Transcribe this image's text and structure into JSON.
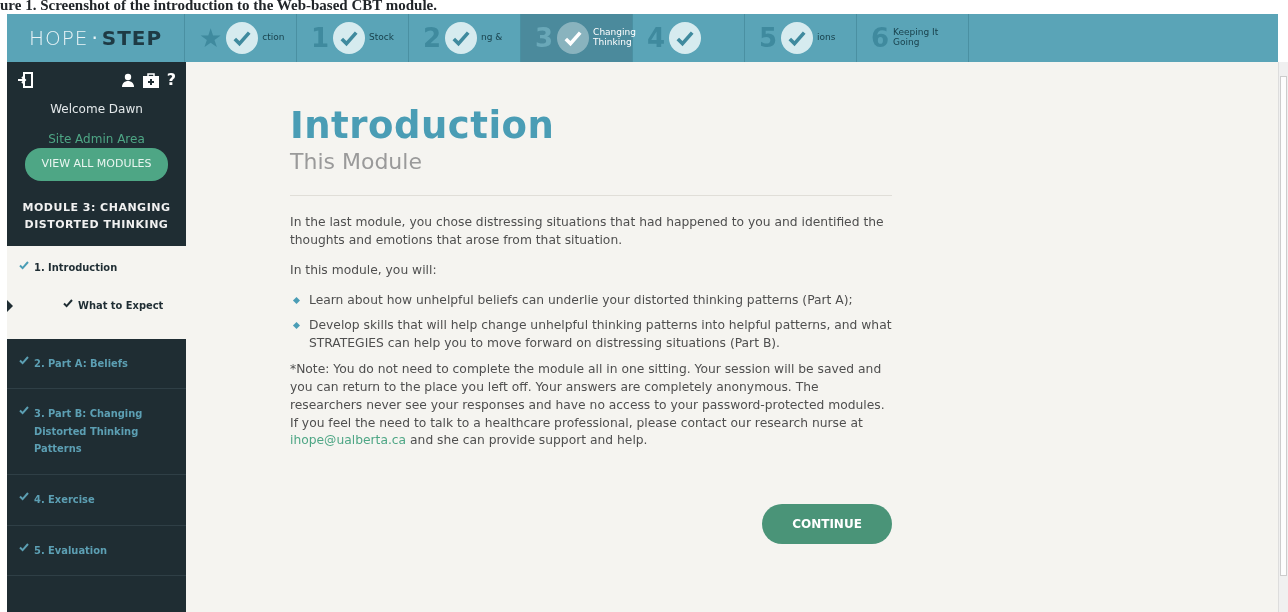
{
  "caption": "ure 1. Screenshot of the introduction to the Web-based CBT module.",
  "brand": {
    "light": "HOPE",
    "dot": "·",
    "bold": "STEP"
  },
  "steps": [
    {
      "number": "★",
      "label": "ction",
      "done": true,
      "selected": false
    },
    {
      "number": "1",
      "label": "Stock",
      "done": true,
      "selected": false
    },
    {
      "number": "2",
      "label": "ng &",
      "done": true,
      "selected": false
    },
    {
      "number": "3",
      "label": "Changing Thinking",
      "done": true,
      "selected": true
    },
    {
      "number": "4",
      "done": true,
      "selected": false
    },
    {
      "number": "5",
      "label": "ions",
      "done": true,
      "selected": false
    },
    {
      "number": "6",
      "label": "Keeping It Going",
      "done": false,
      "selected": false
    }
  ],
  "sidebar": {
    "help": "?",
    "welcome": "Welcome Dawn",
    "admin_link": "Site Admin Area",
    "modules_button": "VIEW ALL MODULES",
    "module_title": "MODULE 3: CHANGING DISTORTED THINKING",
    "items": [
      {
        "label": "1. Introduction",
        "done": true,
        "expanded": true,
        "children": [
          {
            "label": "What to Expect",
            "done": true,
            "selected": true
          }
        ]
      },
      {
        "label": "2. Part A: Beliefs",
        "done": true,
        "expanded": false
      },
      {
        "label": "3. Part B: Changing Distorted Thinking Patterns",
        "done": true,
        "expanded": false
      },
      {
        "label": "4. Exercise",
        "done": true,
        "expanded": false
      },
      {
        "label": "5. Evaluation",
        "done": true,
        "expanded": false
      }
    ]
  },
  "content": {
    "title": "Introduction",
    "subtitle": "This Module",
    "paragraphs": [
      "In the last module, you chose distressing situations that had happened to you and identified the thoughts and emotions that arose from that situation.",
      "In this module, you will:"
    ],
    "bullets": [
      "Learn about how unhelpful beliefs can underlie your distorted thinking patterns (Part A);",
      "Develop skills that will help change unhelpful thinking patterns into helpful patterns, and what STRATEGIES can help you to move forward on distressing situations (Part B)."
    ],
    "note": "*Note: You do not need to complete the module all in one sitting. Your session will be saved and you can return to the place you left off. Your answers are completely anonymous. The researchers never see your responses and have no access to your password-protected modules. If you feel the need to talk to a healthcare professional, please contact our research nurse at",
    "email": "ihope@ualberta.ca",
    "note_end": "and she can provide support and help.",
    "continue_button": "CONTINUE"
  }
}
